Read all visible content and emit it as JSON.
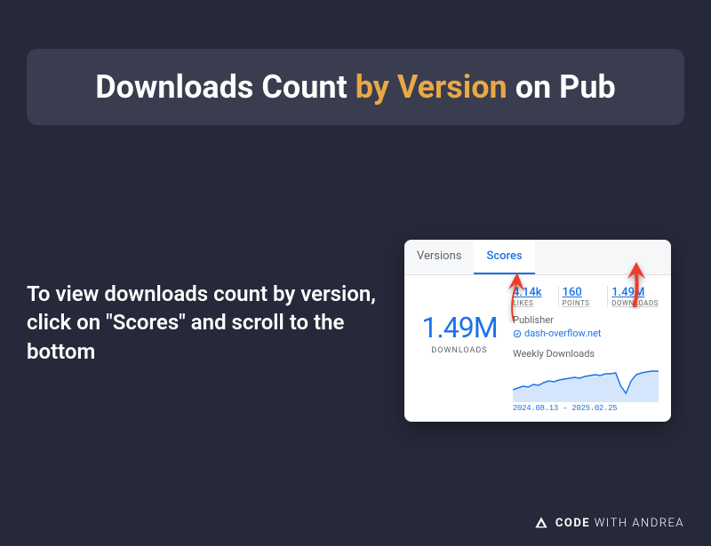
{
  "title": {
    "part1": "Downloads Count ",
    "accent": "by Version",
    "part2": " on Pub"
  },
  "instruction": "To view downloads count by version, click on \"Scores\" and scroll to the bottom",
  "card": {
    "tabs": {
      "versions": "Versions",
      "scores": "Scores"
    },
    "big_number": "1.49M",
    "big_label": "DOWNLOADS",
    "stats": {
      "likes_num": "4.14k",
      "likes_lbl": "LIKES",
      "points_num": "160",
      "points_lbl": "POINTS",
      "downloads_num": "1.49M",
      "downloads_lbl": "DOWNLOADS"
    },
    "publisher_label": "Publisher",
    "publisher_link": "dash-overflow.net",
    "weekly_label": "Weekly Downloads",
    "date_range": "2024.08.13 – 2025.02.25"
  },
  "footer": {
    "brand1": "CODE",
    "brand2": " WITH ANDREA"
  },
  "chart_data": {
    "type": "area",
    "title": "Weekly Downloads",
    "x": [
      0,
      1,
      2,
      3,
      4,
      5,
      6,
      7,
      8,
      9,
      10,
      11,
      12,
      13,
      14,
      15,
      16,
      17,
      18,
      19,
      20,
      21,
      22,
      23,
      24,
      25,
      26,
      27
    ],
    "values": [
      30,
      35,
      40,
      38,
      45,
      42,
      50,
      55,
      52,
      58,
      60,
      62,
      65,
      63,
      68,
      70,
      72,
      69,
      75,
      74,
      76,
      40,
      25,
      55,
      72,
      76,
      78,
      80
    ],
    "date_start": "2024.08.13",
    "date_end": "2025.02.25",
    "ylim": [
      0,
      100
    ]
  }
}
